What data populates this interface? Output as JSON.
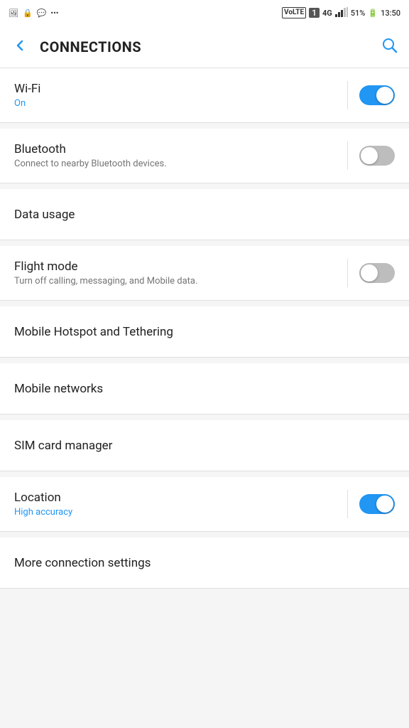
{
  "statusBar": {
    "time": "13:50",
    "battery": "51%",
    "volteLTE": "VoLTE",
    "lte": "4G",
    "icons": [
      "gallery",
      "lock",
      "message",
      "more"
    ]
  },
  "appBar": {
    "title": "CONNECTIONS",
    "backLabel": "Back",
    "searchLabel": "Search"
  },
  "settings": [
    {
      "id": "wifi",
      "title": "Wi-Fi",
      "subtitle": "On",
      "subtitleBlue": true,
      "hasToggle": true,
      "toggleOn": true,
      "hasDivider": true,
      "navigable": false
    },
    {
      "id": "bluetooth",
      "title": "Bluetooth",
      "subtitle": "Connect to nearby Bluetooth devices.",
      "subtitleBlue": false,
      "hasToggle": true,
      "toggleOn": false,
      "hasDivider": true,
      "navigable": false
    },
    {
      "id": "data-usage",
      "title": "Data usage",
      "subtitle": "",
      "subtitleBlue": false,
      "hasToggle": false,
      "hasDivider": false,
      "navigable": true
    },
    {
      "id": "flight-mode",
      "title": "Flight mode",
      "subtitle": "Turn off calling, messaging, and Mobile data.",
      "subtitleBlue": false,
      "hasToggle": true,
      "toggleOn": false,
      "hasDivider": true,
      "navigable": false
    },
    {
      "id": "mobile-hotspot",
      "title": "Mobile Hotspot and Tethering",
      "subtitle": "",
      "subtitleBlue": false,
      "hasToggle": false,
      "hasDivider": false,
      "navigable": true
    },
    {
      "id": "mobile-networks",
      "title": "Mobile networks",
      "subtitle": "",
      "subtitleBlue": false,
      "hasToggle": false,
      "hasDivider": false,
      "navigable": true
    },
    {
      "id": "sim-card",
      "title": "SIM card manager",
      "subtitle": "",
      "subtitleBlue": false,
      "hasToggle": false,
      "hasDivider": false,
      "navigable": true
    },
    {
      "id": "location",
      "title": "Location",
      "subtitle": "High accuracy",
      "subtitleBlue": true,
      "hasToggle": true,
      "toggleOn": true,
      "hasDivider": true,
      "navigable": false
    },
    {
      "id": "more-connection",
      "title": "More connection settings",
      "subtitle": "",
      "subtitleBlue": false,
      "hasToggle": false,
      "hasDivider": false,
      "navigable": true
    }
  ]
}
